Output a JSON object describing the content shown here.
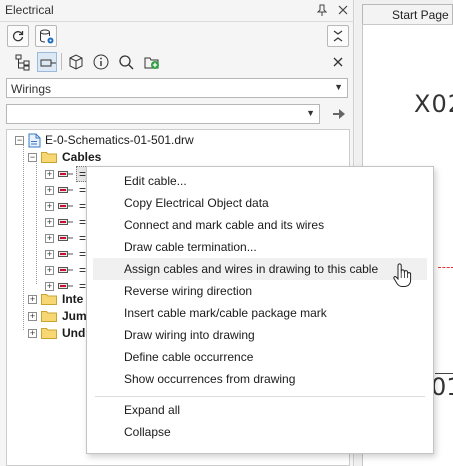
{
  "panel": {
    "title": "Electrical",
    "pin_icon": "pin-icon",
    "close_icon": "close-icon",
    "wiring_combo": {
      "value": "Wirings"
    },
    "filter": {
      "value": ""
    }
  },
  "tree": {
    "root": "E-0-Schematics-01-501.drw",
    "cables": "Cables",
    "cable_rows": [
      "=",
      "=",
      "=",
      "=",
      "=",
      "=",
      "=",
      "="
    ],
    "inte": "Inte",
    "jum": "Jum",
    "und": "Und"
  },
  "document": {
    "tab": "Start Page",
    "text_top": "X02",
    "text_bottom": "01"
  },
  "context_menu": {
    "items": [
      "Edit cable...",
      "Copy Electrical Object data",
      "Connect and mark cable and its wires",
      "Draw cable termination...",
      "Assign cables and wires in drawing to this cable",
      "Reverse wiring direction",
      "Insert cable mark/cable package mark",
      "Draw wiring into drawing",
      "Define cable occurrence",
      "Show occurrences from drawing"
    ],
    "items2": [
      "Expand all",
      "Collapse"
    ],
    "hovered_index": 4
  },
  "colors": {
    "folder": "#f2c94c",
    "accent": "#1f6fbf",
    "cable_red": "#c8102e"
  }
}
